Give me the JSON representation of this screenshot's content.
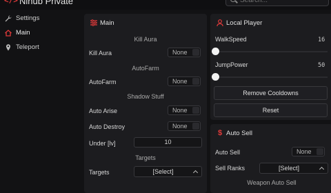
{
  "app": {
    "logo": "</>",
    "title": "Nihub Private"
  },
  "search": {
    "placeholder": "Search..."
  },
  "sidebar": {
    "items": [
      {
        "label": "Settings",
        "icon": "wrench-icon"
      },
      {
        "label": "Main",
        "icon": "home-icon",
        "active": true
      },
      {
        "label": "Teleport",
        "icon": "map-pin-icon"
      }
    ]
  },
  "main": {
    "title": "Main",
    "sections": {
      "kill_aura": "Kill Aura",
      "autofarm": "AutoFarm",
      "shadow": "Shadow Stuff",
      "targets": "Targets"
    },
    "rows": {
      "kill_aura": {
        "label": "Kill Aura",
        "value": "None"
      },
      "autofarm": {
        "label": "AutoFarm",
        "value": "None"
      },
      "auto_arise": {
        "label": "Auto Arise",
        "value": "None"
      },
      "auto_destroy": {
        "label": "Auto Destroy",
        "value": "None"
      },
      "under_lv": {
        "label": "Under [lv]",
        "value": "10"
      },
      "targets": {
        "label": "Targets",
        "value": "[Select]"
      }
    }
  },
  "local_player": {
    "title": "Local Player",
    "walkspeed": {
      "label": "WalkSpeed",
      "value": "16",
      "fraction": 0.0
    },
    "jumppower": {
      "label": "JumpPower",
      "value": "50",
      "fraction": 0.0
    },
    "remove_cooldowns": "Remove Cooldowns",
    "reset": "Reset"
  },
  "auto_sell": {
    "title": "Auto Sell",
    "auto_sell": {
      "label": "Auto Sell",
      "value": "None"
    },
    "sell_ranks": {
      "label": "Sell Ranks",
      "value": "[Select]"
    },
    "weapon_section": "Weapon Auto Sell"
  },
  "colors": {
    "accent": "#e23a3a",
    "panel": "#1c1c1f",
    "background": "#121214"
  }
}
